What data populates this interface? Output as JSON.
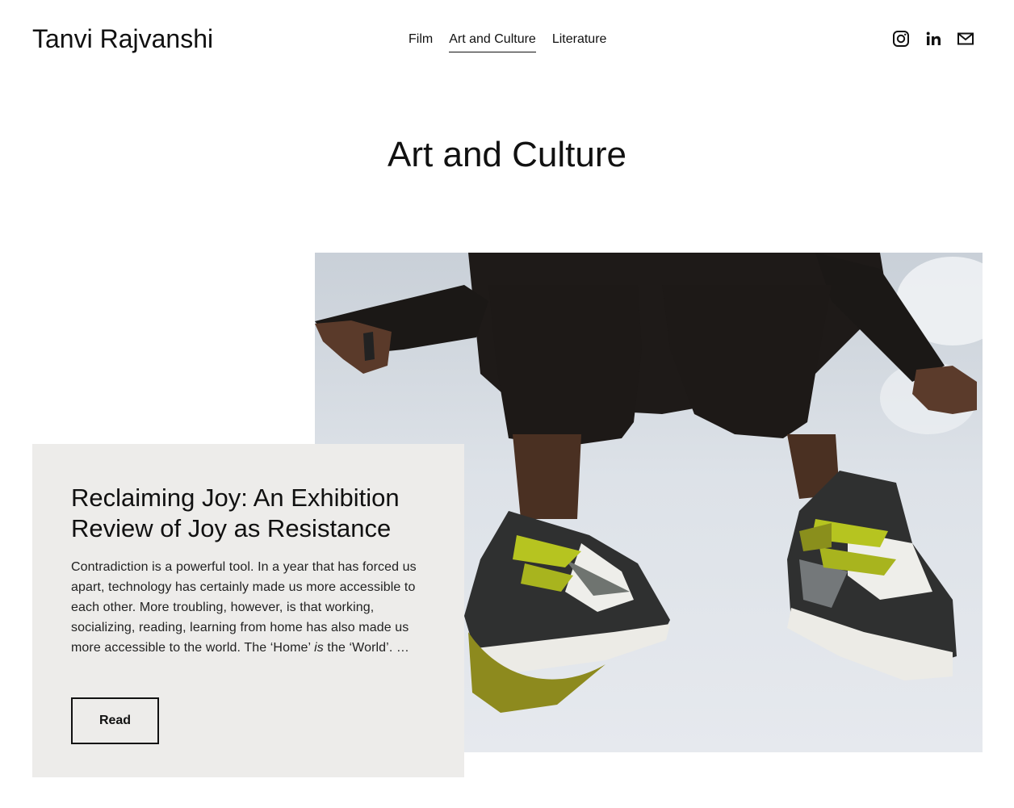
{
  "site": {
    "title": "Tanvi Rajvanshi"
  },
  "nav": {
    "items": [
      {
        "label": "Film",
        "active": false
      },
      {
        "label": "Art and Culture",
        "active": true
      },
      {
        "label": "Literature",
        "active": false
      }
    ]
  },
  "social": {
    "icons": [
      "instagram-icon",
      "linkedin-icon",
      "email-icon"
    ]
  },
  "page": {
    "title": "Art and Culture"
  },
  "post": {
    "title": "Reclaiming Joy: An Exhibition Review of Joy as Resistance",
    "excerpt_before": "Contradiction is a powerful tool. In a year that has forced us apart, technology has certainly made us more accessible to each other. More troubling, however, is that working, socializing, reading, learning from home has also made us more accessible to the world. The ‘Home’ ",
    "excerpt_emphasis": "is",
    "excerpt_after": " the ‘World’. …",
    "read_label": "Read",
    "image_icon": "sneakers-jump-photo"
  },
  "colors": {
    "card_background": "#edecea",
    "sky": "#dde2e8",
    "sneaker_lime": "#a8b41e"
  }
}
